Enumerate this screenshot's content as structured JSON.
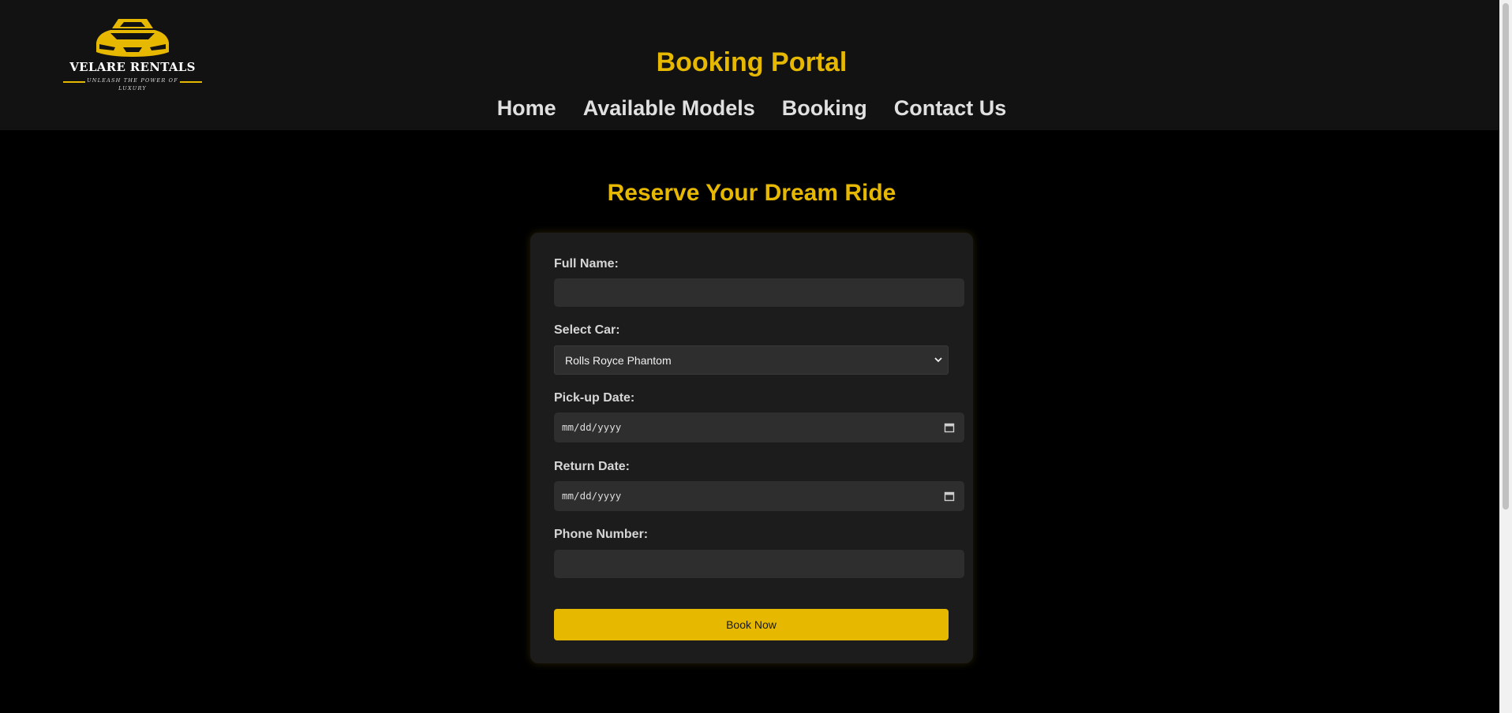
{
  "brand": {
    "name": "VELARE RENTALS",
    "tagline": "UNLEASH THE POWER OF LUXURY",
    "accent_color": "#e6b800",
    "logo_icon": "sports-car-icon"
  },
  "header": {
    "title": "Booking Portal",
    "nav": [
      "Home",
      "Available Models",
      "Booking",
      "Contact Us"
    ]
  },
  "main": {
    "section_title": "Reserve Your Dream Ride",
    "form": {
      "full_name": {
        "label": "Full Name:",
        "value": ""
      },
      "car": {
        "label": "Select Car:",
        "selected": "Rolls Royce Phantom"
      },
      "pickup_date": {
        "label": "Pick-up Date:",
        "placeholder": "mm/dd/yyyy"
      },
      "return_date": {
        "label": "Return Date:",
        "placeholder": "mm/dd/yyyy"
      },
      "phone": {
        "label": "Phone Number:",
        "value": ""
      },
      "submit_label": "Book Now"
    }
  }
}
